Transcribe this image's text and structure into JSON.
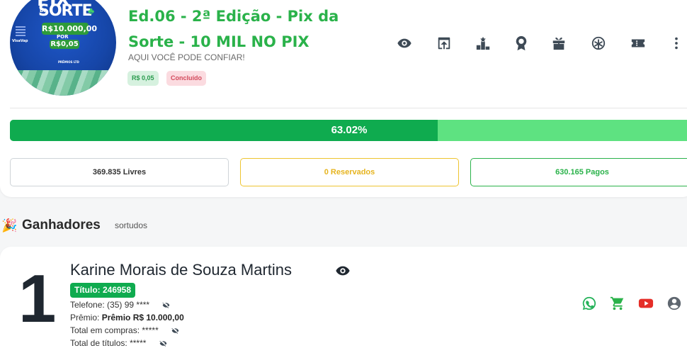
{
  "raffle": {
    "title": "Ed.06 - 2ª Edição - Pix da Sorte - 10 MIL NO PIX",
    "subtitle": "AQUI VOCÊ PODE CONFIAR!",
    "price_badge": "R$ 0,05",
    "status_badge": "Concluído",
    "image": {
      "brand": "PIX",
      "da": "DA",
      "sorte": "SORTE",
      "prize": "R$10.000,00",
      "por": "POR",
      "price": "R$0,05",
      "left_tag": "VisaVap",
      "footer": "PRÊMIOS LTD"
    }
  },
  "actions": [
    {
      "name": "view-icon"
    },
    {
      "name": "share-icon"
    },
    {
      "name": "ranking-icon"
    },
    {
      "name": "award-icon"
    },
    {
      "name": "gift-icon"
    },
    {
      "name": "roulette-icon"
    },
    {
      "name": "ticket-icon"
    },
    {
      "name": "more-vertical-icon"
    }
  ],
  "progress": {
    "value": 0.6302,
    "label": "63.02%"
  },
  "stats": {
    "free": "369.835 Livres",
    "reserved": "0 Reservados",
    "paid": "630.165 Pagos"
  },
  "winners_section": {
    "title": "Ganhadores",
    "subtitle": "sortudos"
  },
  "winner": {
    "rank": "1",
    "name": "Karine Morais de Souza Martins",
    "ticket": "Título: 246958",
    "phone_label": "Telefone:",
    "phone_value": "(35) 99 ****",
    "prize_label": "Prêmio:",
    "prize_value": "Prêmio R$ 10.000,00",
    "purchases_label": "Total em compras:",
    "purchases_value": "*****",
    "titles_label": "Total de títulos:",
    "titles_value": "*****"
  },
  "colors": {
    "brand_green": "#2ab24a",
    "progress_fill": "#0fab4f",
    "progress_track": "#5ee281",
    "reserved_yellow": "#e6b41f",
    "status_red": "#d34a5c",
    "whatsapp": "#25b25a",
    "youtube": "#e52d27"
  }
}
